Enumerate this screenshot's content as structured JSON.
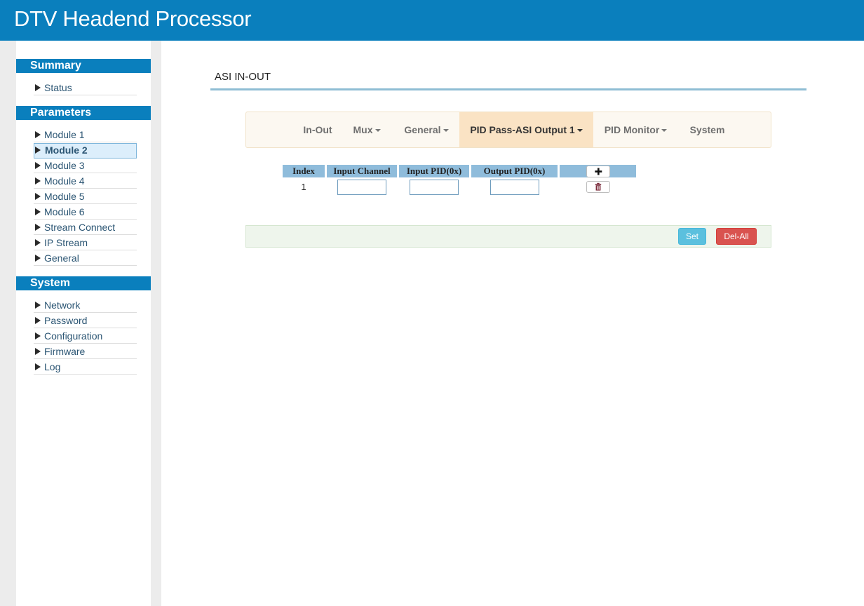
{
  "header": {
    "title": "DTV Headend Processor"
  },
  "sidebar": {
    "sections": [
      {
        "title": "Summary",
        "items": [
          {
            "label": "Status"
          }
        ]
      },
      {
        "title": "Parameters",
        "items": [
          {
            "label": "Module 1"
          },
          {
            "label": "Module 2",
            "active": true
          },
          {
            "label": "Module 3"
          },
          {
            "label": "Module 4"
          },
          {
            "label": "Module 5"
          },
          {
            "label": "Module 6"
          },
          {
            "label": "Stream Connect"
          },
          {
            "label": "IP Stream"
          },
          {
            "label": "General"
          }
        ]
      },
      {
        "title": "System",
        "items": [
          {
            "label": "Network"
          },
          {
            "label": "Password"
          },
          {
            "label": "Configuration"
          },
          {
            "label": "Firmware"
          },
          {
            "label": "Log"
          }
        ]
      }
    ]
  },
  "page": {
    "title": "ASI IN-OUT"
  },
  "tabs": [
    {
      "label": "In-Out",
      "dropdown": false
    },
    {
      "label": "Mux",
      "dropdown": true
    },
    {
      "label": "General",
      "dropdown": true
    },
    {
      "label": "PID Pass-ASI Output 1",
      "dropdown": true,
      "active": true
    },
    {
      "label": "PID Monitor",
      "dropdown": true
    },
    {
      "label": "System",
      "dropdown": false
    }
  ],
  "table": {
    "headers": [
      "Index",
      "Input Channel",
      "Input PID(0x)",
      "Output PID(0x)"
    ],
    "add_icon": "plus-icon",
    "rows": [
      {
        "index": "1",
        "input_channel": "",
        "input_pid": "",
        "output_pid": "",
        "delete_icon": "trash-icon"
      }
    ]
  },
  "actions": {
    "set_label": "Set",
    "del_all_label": "Del-All"
  },
  "colors": {
    "header_bg": "#0a7fbd",
    "section_bg": "#0a7fbd",
    "table_header_bg": "#8fbcdb",
    "tab_active_bg": "#fae3c4",
    "set_button": "#5bc0de",
    "del_all_button": "#d9534f"
  }
}
